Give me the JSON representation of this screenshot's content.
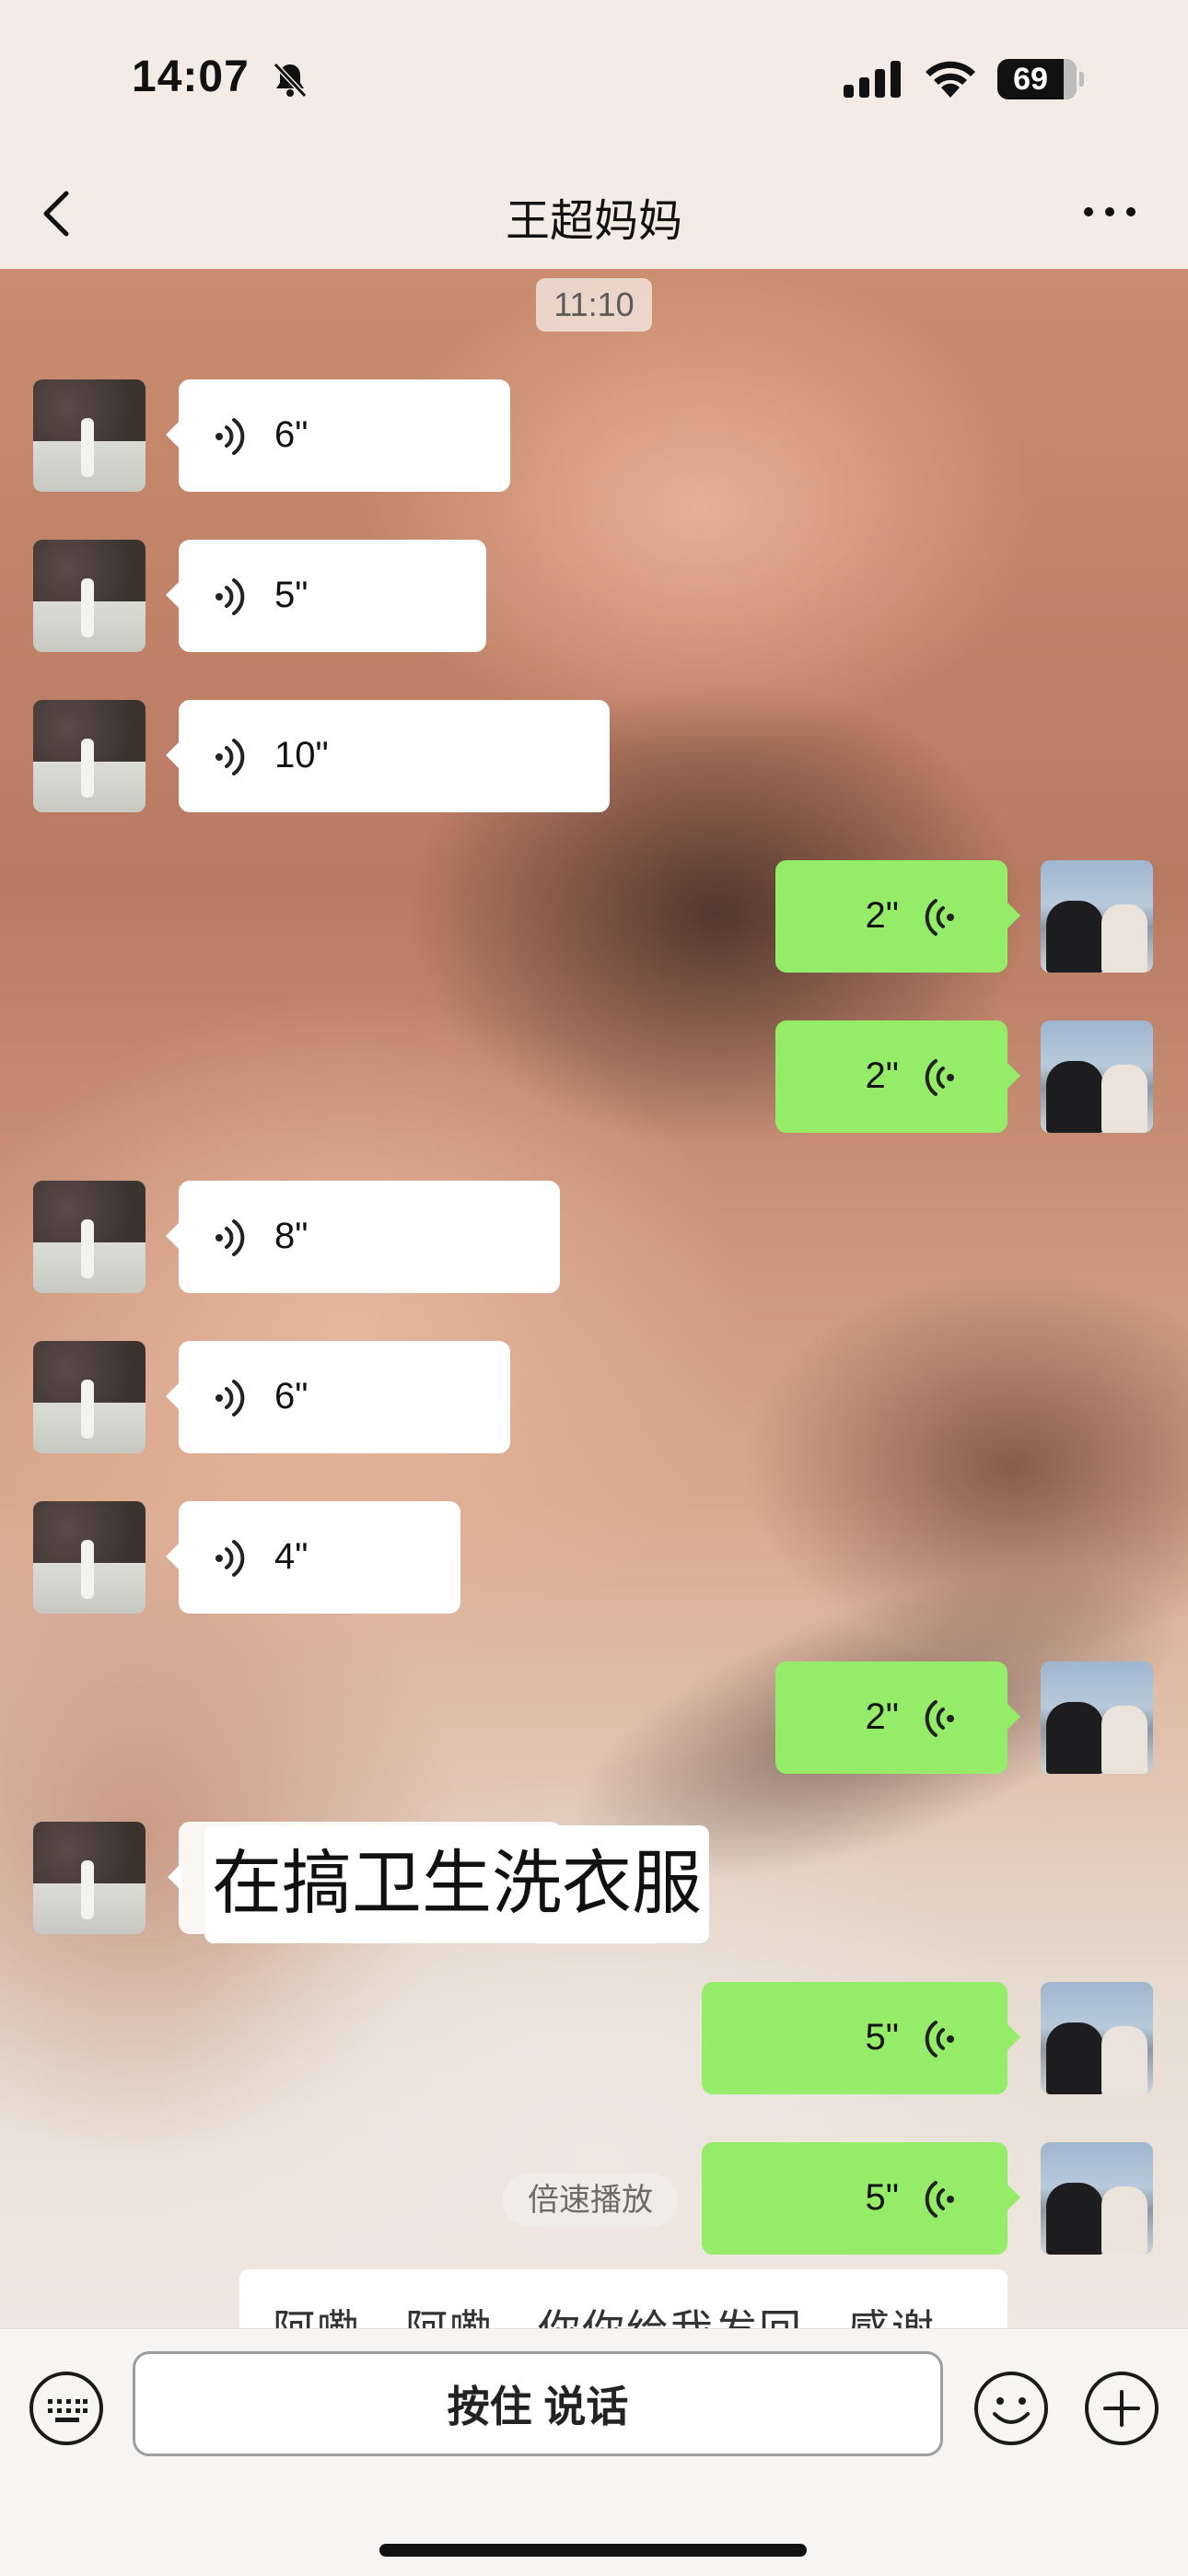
{
  "status_bar": {
    "time": "14:07",
    "battery": "69",
    "icons": [
      "bell-off-icon",
      "signal-icon",
      "wifi-icon",
      "battery-icon"
    ]
  },
  "nav": {
    "title": "王超妈妈",
    "back_icon": "back-chevron-icon",
    "more_icon": "more-dots-icon"
  },
  "timestamp": "11:10",
  "messages": [
    {
      "side": "in",
      "type": "voice",
      "duration": "6\""
    },
    {
      "side": "in",
      "type": "voice",
      "duration": "5\""
    },
    {
      "side": "in",
      "type": "voice",
      "duration": "10\""
    },
    {
      "side": "out",
      "type": "voice",
      "duration": "2\""
    },
    {
      "side": "out",
      "type": "voice",
      "duration": "2\""
    },
    {
      "side": "in",
      "type": "voice",
      "duration": "8\""
    },
    {
      "side": "in",
      "type": "voice",
      "duration": "6\""
    },
    {
      "side": "in",
      "type": "voice",
      "duration": "4\""
    },
    {
      "side": "out",
      "type": "voice",
      "duration": "2\""
    },
    {
      "side": "in",
      "type": "text",
      "text": "在搞卫生洗衣服"
    },
    {
      "side": "out",
      "type": "voice",
      "duration": "5\""
    },
    {
      "side": "out",
      "type": "voice",
      "duration": "5\""
    }
  ],
  "speed_chip": "倍速播放",
  "partial_text": "阿嘞，阿嘞，你你给我发回，感谢",
  "input_bar": {
    "hold_to_talk": "按住 说话",
    "left_icon": "keyboard-icon",
    "right_icons": [
      "emoji-icon",
      "plus-icon"
    ]
  },
  "colors": {
    "outgoing_bubble": "#95ec69",
    "incoming_bubble": "#ffffff"
  }
}
